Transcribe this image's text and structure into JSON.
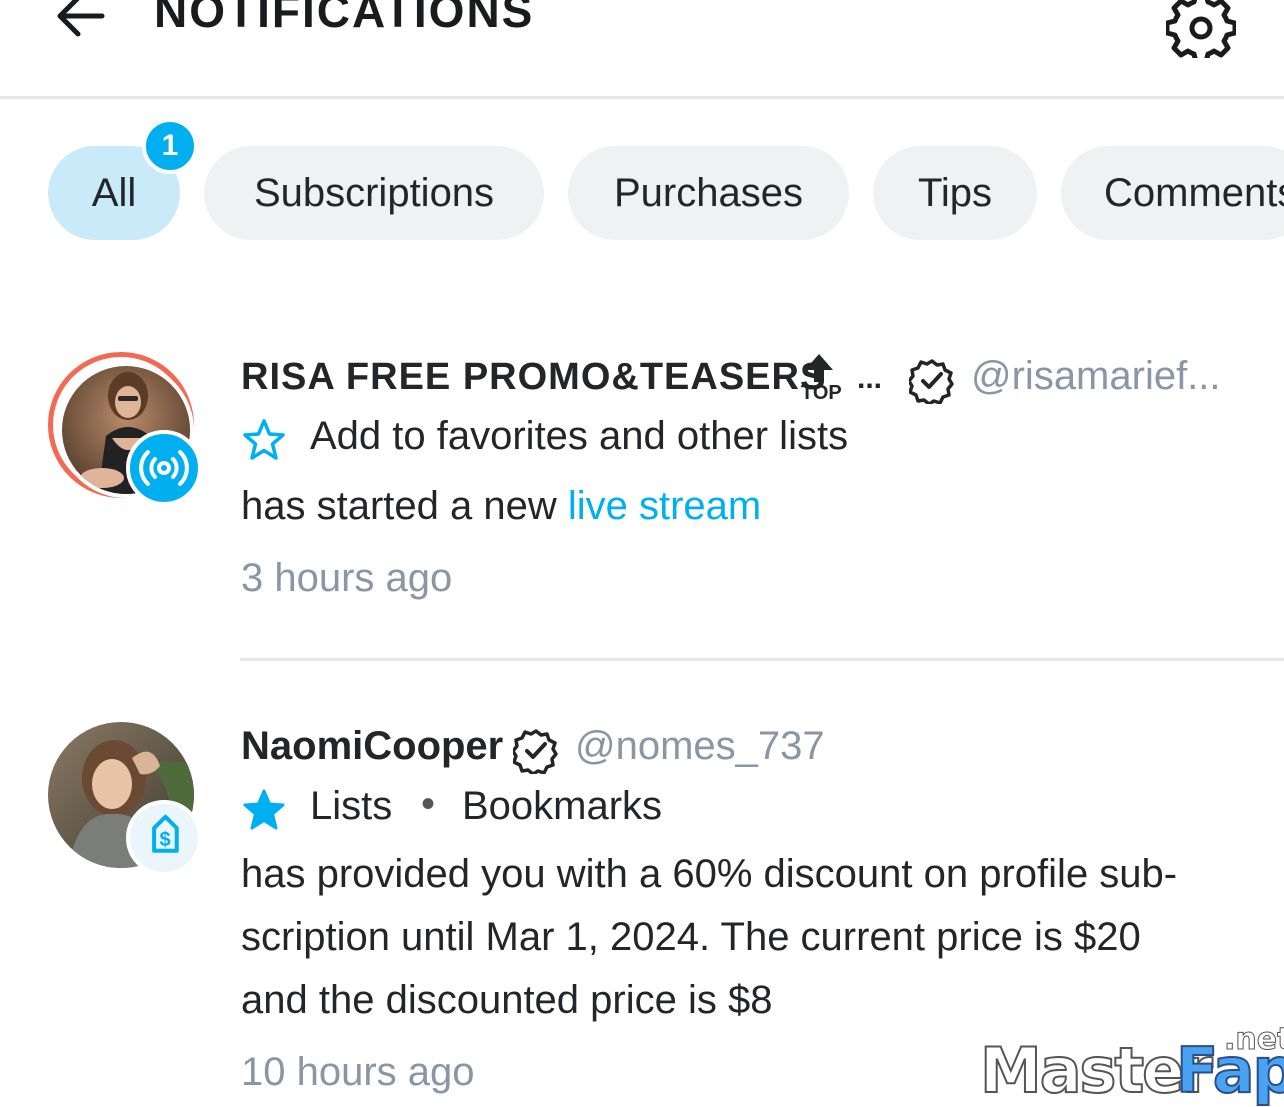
{
  "header": {
    "title": "NOTIFICATIONS"
  },
  "tabs": [
    {
      "label": "All",
      "active": true,
      "badge": "1"
    },
    {
      "label": "Subscriptions",
      "active": false
    },
    {
      "label": "Purchases",
      "active": false
    },
    {
      "label": "Tips",
      "active": false
    },
    {
      "label": "Comments",
      "active": false
    }
  ],
  "notifications": [
    {
      "name": "RISA FREE PROMO&TEASERS",
      "top_badge": "TOP",
      "ellipsis": "...",
      "handle": "@risamarief...",
      "list_action": "Add to favorites and other lists",
      "message_prefix": "has started a new ",
      "message_link": "live stream",
      "time": "3 hours ago",
      "type_icon": "live-stream-icon",
      "ring_color": "#f26a52"
    },
    {
      "name": "NaomiCooper",
      "handle": "@nomes_737",
      "lists": [
        "Lists",
        "Bookmarks"
      ],
      "lists_separator": "•",
      "message_lines": [
        "has provided you with a 60% discount on profile sub-",
        "scription until Mar 1, 2024. The current price is $20",
        "and the discounted price is $8"
      ],
      "time": "10 hours ago",
      "type_icon": "price-tag-icon"
    }
  ],
  "watermark": {
    "part1": "Master",
    "part2": "Fap",
    "suffix": ".net"
  },
  "colors": {
    "accent": "#00aff0",
    "muted": "#8a96a3",
    "active_tab": "#c9ebf9",
    "tab_bg": "#f0f1f3"
  }
}
